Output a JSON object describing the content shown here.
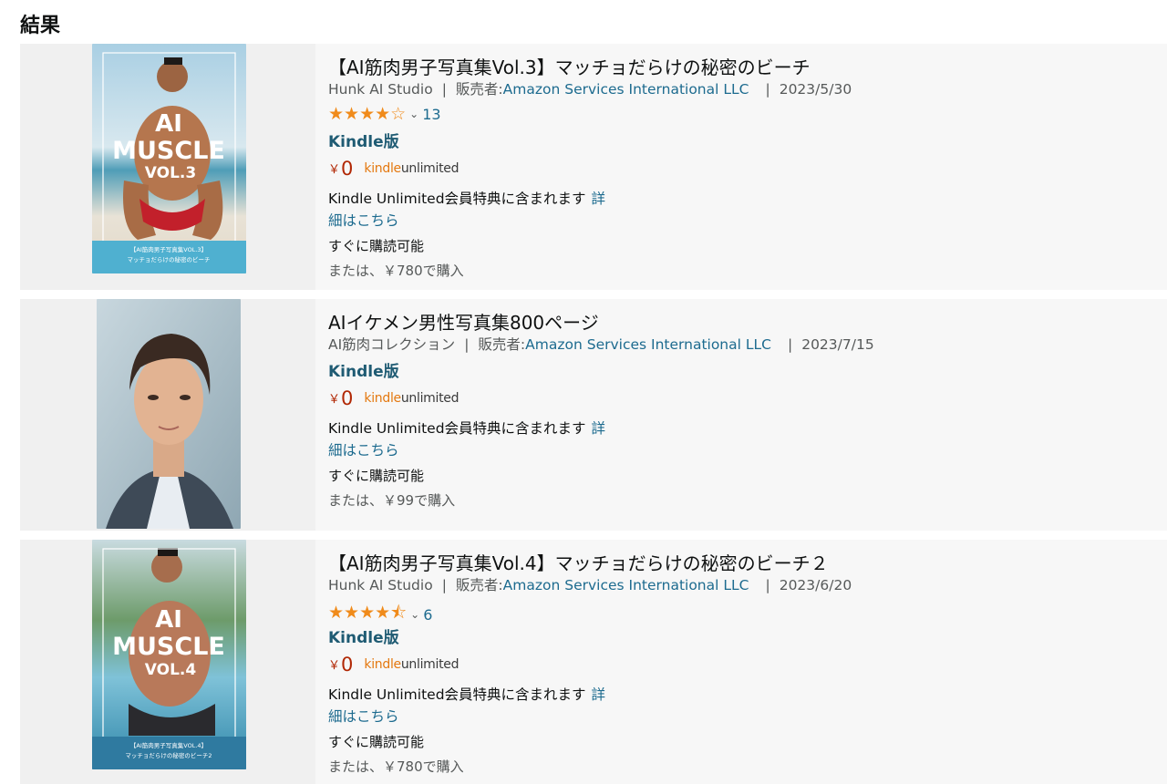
{
  "page": {
    "heading": "結果"
  },
  "results": [
    {
      "title": "【AI筋肉男子写真集Vol.3】マッチョだらけの秘密のビーチ",
      "author": "Hunk AI Studio",
      "seller_prefix": "販売者:",
      "seller": "Amazon Services International LLC",
      "date": "2023/5/30",
      "rating": 4.0,
      "stars_text": "★★★★☆",
      "review_count": "13",
      "format": "Kindle版",
      "currency": "￥",
      "price": "0",
      "ku_logo_a": "kindle",
      "ku_logo_b": "unlimited",
      "ku_text": "Kindle Unlimited会員特典に含まれます",
      "ku_link_a": "詳",
      "ku_link_b": "細はこちら",
      "availability": "すぐに購読可能",
      "alt_buy": "または、￥780で購入",
      "cover": {
        "big1": "AI",
        "big2": "MUSCLE",
        "vol": "VOL.3",
        "band1": "【AI筋肉男子写真集VOL.3】",
        "band2": "マッチョだらけの秘密のビーチ",
        "accent": "#4fb0d0"
      }
    },
    {
      "title": "AIイケメン男性写真集800ページ",
      "author": "AI筋肉コレクション",
      "seller_prefix": "販売者:",
      "seller": "Amazon Services International LLC",
      "date": "2023/7/15",
      "format": "Kindle版",
      "currency": "￥",
      "price": "0",
      "ku_logo_a": "kindle",
      "ku_logo_b": "unlimited",
      "ku_text": "Kindle Unlimited会員特典に含まれます",
      "ku_link_a": "詳",
      "ku_link_b": "細はこちら",
      "availability": "すぐに購読可能",
      "alt_buy": "または、￥99で購入"
    },
    {
      "title": "【AI筋肉男子写真集Vol.4】マッチョだらけの秘密のビーチ２",
      "author": "Hunk AI Studio",
      "seller_prefix": "販売者:",
      "seller": "Amazon Services International LLC",
      "date": "2023/6/20",
      "rating": 4.5,
      "stars_text": "★★★★⯪",
      "review_count": "6",
      "format": "Kindle版",
      "currency": "￥",
      "price": "0",
      "ku_logo_a": "kindle",
      "ku_logo_b": "unlimited",
      "ku_text": "Kindle Unlimited会員特典に含まれます",
      "ku_link_a": "詳",
      "ku_link_b": "細はこちら",
      "availability": "すぐに購読可能",
      "alt_buy": "または、￥780で購入",
      "cover": {
        "big1": "AI",
        "big2": "MUSCLE",
        "vol": "VOL.4",
        "band1": "【AI筋肉男子写真集VOL.4】",
        "band2": "マッチョだらけの秘密のビーチ2",
        "accent": "#2f7aa0"
      }
    }
  ]
}
